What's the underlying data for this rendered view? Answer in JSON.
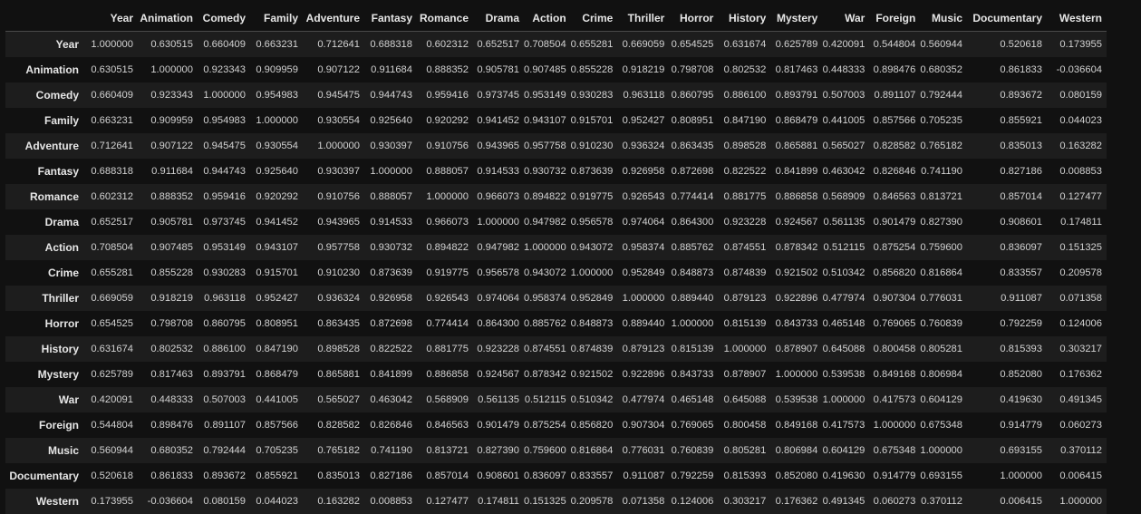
{
  "table": {
    "index_header": "",
    "columns": [
      "Year",
      "Animation",
      "Comedy",
      "Family",
      "Adventure",
      "Fantasy",
      "Romance",
      "Drama",
      "Action",
      "Crime",
      "Thriller",
      "Horror",
      "History",
      "Mystery",
      "War",
      "Foreign",
      "Music",
      "Documentary",
      "Western"
    ],
    "rows": [
      {
        "label": "Year",
        "values": [
          "1.000000",
          "0.630515",
          "0.660409",
          "0.663231",
          "0.712641",
          "0.688318",
          "0.602312",
          "0.652517",
          "0.708504",
          "0.655281",
          "0.669059",
          "0.654525",
          "0.631674",
          "0.625789",
          "0.420091",
          "0.544804",
          "0.560944",
          "0.520618",
          "0.173955"
        ]
      },
      {
        "label": "Animation",
        "values": [
          "0.630515",
          "1.000000",
          "0.923343",
          "0.909959",
          "0.907122",
          "0.911684",
          "0.888352",
          "0.905781",
          "0.907485",
          "0.855228",
          "0.918219",
          "0.798708",
          "0.802532",
          "0.817463",
          "0.448333",
          "0.898476",
          "0.680352",
          "0.861833",
          "-0.036604"
        ]
      },
      {
        "label": "Comedy",
        "values": [
          "0.660409",
          "0.923343",
          "1.000000",
          "0.954983",
          "0.945475",
          "0.944743",
          "0.959416",
          "0.973745",
          "0.953149",
          "0.930283",
          "0.963118",
          "0.860795",
          "0.886100",
          "0.893791",
          "0.507003",
          "0.891107",
          "0.792444",
          "0.893672",
          "0.080159"
        ]
      },
      {
        "label": "Family",
        "values": [
          "0.663231",
          "0.909959",
          "0.954983",
          "1.000000",
          "0.930554",
          "0.925640",
          "0.920292",
          "0.941452",
          "0.943107",
          "0.915701",
          "0.952427",
          "0.808951",
          "0.847190",
          "0.868479",
          "0.441005",
          "0.857566",
          "0.705235",
          "0.855921",
          "0.044023"
        ]
      },
      {
        "label": "Adventure",
        "values": [
          "0.712641",
          "0.907122",
          "0.945475",
          "0.930554",
          "1.000000",
          "0.930397",
          "0.910756",
          "0.943965",
          "0.957758",
          "0.910230",
          "0.936324",
          "0.863435",
          "0.898528",
          "0.865881",
          "0.565027",
          "0.828582",
          "0.765182",
          "0.835013",
          "0.163282"
        ]
      },
      {
        "label": "Fantasy",
        "values": [
          "0.688318",
          "0.911684",
          "0.944743",
          "0.925640",
          "0.930397",
          "1.000000",
          "0.888057",
          "0.914533",
          "0.930732",
          "0.873639",
          "0.926958",
          "0.872698",
          "0.822522",
          "0.841899",
          "0.463042",
          "0.826846",
          "0.741190",
          "0.827186",
          "0.008853"
        ]
      },
      {
        "label": "Romance",
        "values": [
          "0.602312",
          "0.888352",
          "0.959416",
          "0.920292",
          "0.910756",
          "0.888057",
          "1.000000",
          "0.966073",
          "0.894822",
          "0.919775",
          "0.926543",
          "0.774414",
          "0.881775",
          "0.886858",
          "0.568909",
          "0.846563",
          "0.813721",
          "0.857014",
          "0.127477"
        ]
      },
      {
        "label": "Drama",
        "values": [
          "0.652517",
          "0.905781",
          "0.973745",
          "0.941452",
          "0.943965",
          "0.914533",
          "0.966073",
          "1.000000",
          "0.947982",
          "0.956578",
          "0.974064",
          "0.864300",
          "0.923228",
          "0.924567",
          "0.561135",
          "0.901479",
          "0.827390",
          "0.908601",
          "0.174811"
        ]
      },
      {
        "label": "Action",
        "values": [
          "0.708504",
          "0.907485",
          "0.953149",
          "0.943107",
          "0.957758",
          "0.930732",
          "0.894822",
          "0.947982",
          "1.000000",
          "0.943072",
          "0.958374",
          "0.885762",
          "0.874551",
          "0.878342",
          "0.512115",
          "0.875254",
          "0.759600",
          "0.836097",
          "0.151325"
        ]
      },
      {
        "label": "Crime",
        "values": [
          "0.655281",
          "0.855228",
          "0.930283",
          "0.915701",
          "0.910230",
          "0.873639",
          "0.919775",
          "0.956578",
          "0.943072",
          "1.000000",
          "0.952849",
          "0.848873",
          "0.874839",
          "0.921502",
          "0.510342",
          "0.856820",
          "0.816864",
          "0.833557",
          "0.209578"
        ]
      },
      {
        "label": "Thriller",
        "values": [
          "0.669059",
          "0.918219",
          "0.963118",
          "0.952427",
          "0.936324",
          "0.926958",
          "0.926543",
          "0.974064",
          "0.958374",
          "0.952849",
          "1.000000",
          "0.889440",
          "0.879123",
          "0.922896",
          "0.477974",
          "0.907304",
          "0.776031",
          "0.911087",
          "0.071358"
        ]
      },
      {
        "label": "Horror",
        "values": [
          "0.654525",
          "0.798708",
          "0.860795",
          "0.808951",
          "0.863435",
          "0.872698",
          "0.774414",
          "0.864300",
          "0.885762",
          "0.848873",
          "0.889440",
          "1.000000",
          "0.815139",
          "0.843733",
          "0.465148",
          "0.769065",
          "0.760839",
          "0.792259",
          "0.124006"
        ]
      },
      {
        "label": "History",
        "values": [
          "0.631674",
          "0.802532",
          "0.886100",
          "0.847190",
          "0.898528",
          "0.822522",
          "0.881775",
          "0.923228",
          "0.874551",
          "0.874839",
          "0.879123",
          "0.815139",
          "1.000000",
          "0.878907",
          "0.645088",
          "0.800458",
          "0.805281",
          "0.815393",
          "0.303217"
        ]
      },
      {
        "label": "Mystery",
        "values": [
          "0.625789",
          "0.817463",
          "0.893791",
          "0.868479",
          "0.865881",
          "0.841899",
          "0.886858",
          "0.924567",
          "0.878342",
          "0.921502",
          "0.922896",
          "0.843733",
          "0.878907",
          "1.000000",
          "0.539538",
          "0.849168",
          "0.806984",
          "0.852080",
          "0.176362"
        ]
      },
      {
        "label": "War",
        "values": [
          "0.420091",
          "0.448333",
          "0.507003",
          "0.441005",
          "0.565027",
          "0.463042",
          "0.568909",
          "0.561135",
          "0.512115",
          "0.510342",
          "0.477974",
          "0.465148",
          "0.645088",
          "0.539538",
          "1.000000",
          "0.417573",
          "0.604129",
          "0.419630",
          "0.491345"
        ]
      },
      {
        "label": "Foreign",
        "values": [
          "0.544804",
          "0.898476",
          "0.891107",
          "0.857566",
          "0.828582",
          "0.826846",
          "0.846563",
          "0.901479",
          "0.875254",
          "0.856820",
          "0.907304",
          "0.769065",
          "0.800458",
          "0.849168",
          "0.417573",
          "1.000000",
          "0.675348",
          "0.914779",
          "0.060273"
        ]
      },
      {
        "label": "Music",
        "values": [
          "0.560944",
          "0.680352",
          "0.792444",
          "0.705235",
          "0.765182",
          "0.741190",
          "0.813721",
          "0.827390",
          "0.759600",
          "0.816864",
          "0.776031",
          "0.760839",
          "0.805281",
          "0.806984",
          "0.604129",
          "0.675348",
          "1.000000",
          "0.693155",
          "0.370112"
        ]
      },
      {
        "label": "Documentary",
        "values": [
          "0.520618",
          "0.861833",
          "0.893672",
          "0.855921",
          "0.835013",
          "0.827186",
          "0.857014",
          "0.908601",
          "0.836097",
          "0.833557",
          "0.911087",
          "0.792259",
          "0.815393",
          "0.852080",
          "0.419630",
          "0.914779",
          "0.693155",
          "1.000000",
          "0.006415"
        ]
      },
      {
        "label": "Western",
        "values": [
          "0.173955",
          "-0.036604",
          "0.080159",
          "0.044023",
          "0.163282",
          "0.008853",
          "0.127477",
          "0.174811",
          "0.151325",
          "0.209578",
          "0.071358",
          "0.124006",
          "0.303217",
          "0.176362",
          "0.491345",
          "0.060273",
          "0.370112",
          "0.006415",
          "1.000000"
        ]
      }
    ]
  }
}
